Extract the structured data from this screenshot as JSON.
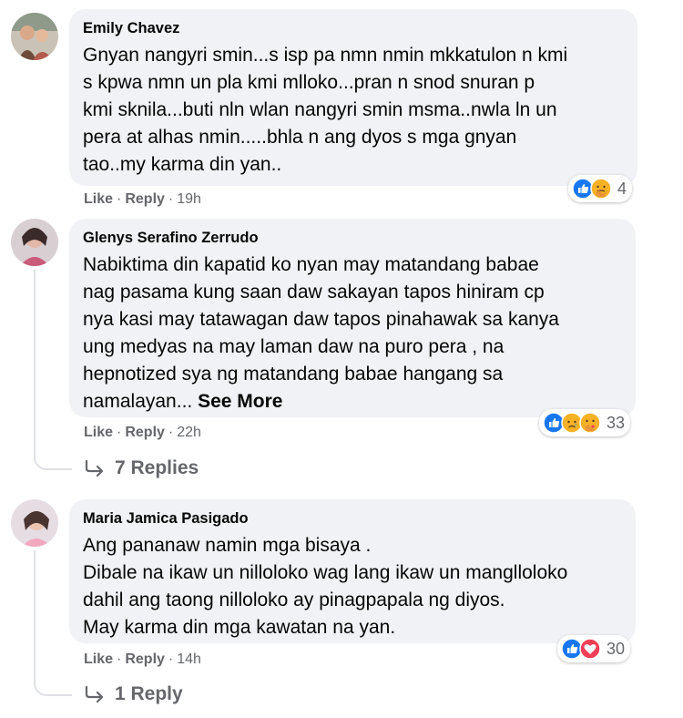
{
  "comments": [
    {
      "author": "Emily Chavez",
      "lines": [
        "Gnyan nangyri smin...s isp pa nmn nmin mkkatulon n kmi",
        "s kpwa nmn un pla kmi mlloko...pran n snod snuran p",
        "kmi sknila...buti nln wlan nangyri smin msma..nwla ln un",
        "pera at alhas nmin.....bhla n ang dyos s mga gnyan",
        "tao..my karma din yan.."
      ],
      "like_label": "Like",
      "reply_label": "Reply",
      "separator": "·",
      "time": "19h",
      "reaction_icons": [
        "like-icon",
        "care-icon"
      ],
      "reaction_count": "4"
    },
    {
      "author": "Glenys Serafino Zerrudo",
      "lines": [
        "Nabiktima din kapatid ko nyan may matandang babae",
        "nag pasama kung saan daw sakayan tapos hiniram cp",
        "nya kasi may tatawagan daw tapos pinahawak sa kanya",
        "ung medyas na may laman daw na puro pera , na",
        "hepnotized sya ng matandang babae hangang sa",
        "namalayan... "
      ],
      "see_more": "See More",
      "like_label": "Like",
      "reply_label": "Reply",
      "separator": "·",
      "time": "22h",
      "reaction_icons": [
        "like-icon",
        "sad-icon",
        "care-icon"
      ],
      "reaction_count": "33",
      "replies_label": "7 Replies"
    },
    {
      "author": "Maria Jamica Pasigado",
      "lines": [
        "Ang pananaw namin mga bisaya .",
        "Dibale na ikaw un nilloloko wag lang ikaw un manglloloko",
        "dahil ang taong nilloloko ay pinagpapala ng diyos.",
        "May karma din mga kawatan na yan."
      ],
      "like_label": "Like",
      "reply_label": "Reply",
      "separator": "·",
      "time": "14h",
      "reaction_icons": [
        "like-icon",
        "love-icon"
      ],
      "reaction_count": "30",
      "replies_label": "1 Reply"
    }
  ],
  "colors": {
    "bubble": "#f0f2f5",
    "secondary_text": "#65676b",
    "like_blue": "#1877f2",
    "love_red": "#f33e58",
    "care_yellow": "#f7b125"
  }
}
